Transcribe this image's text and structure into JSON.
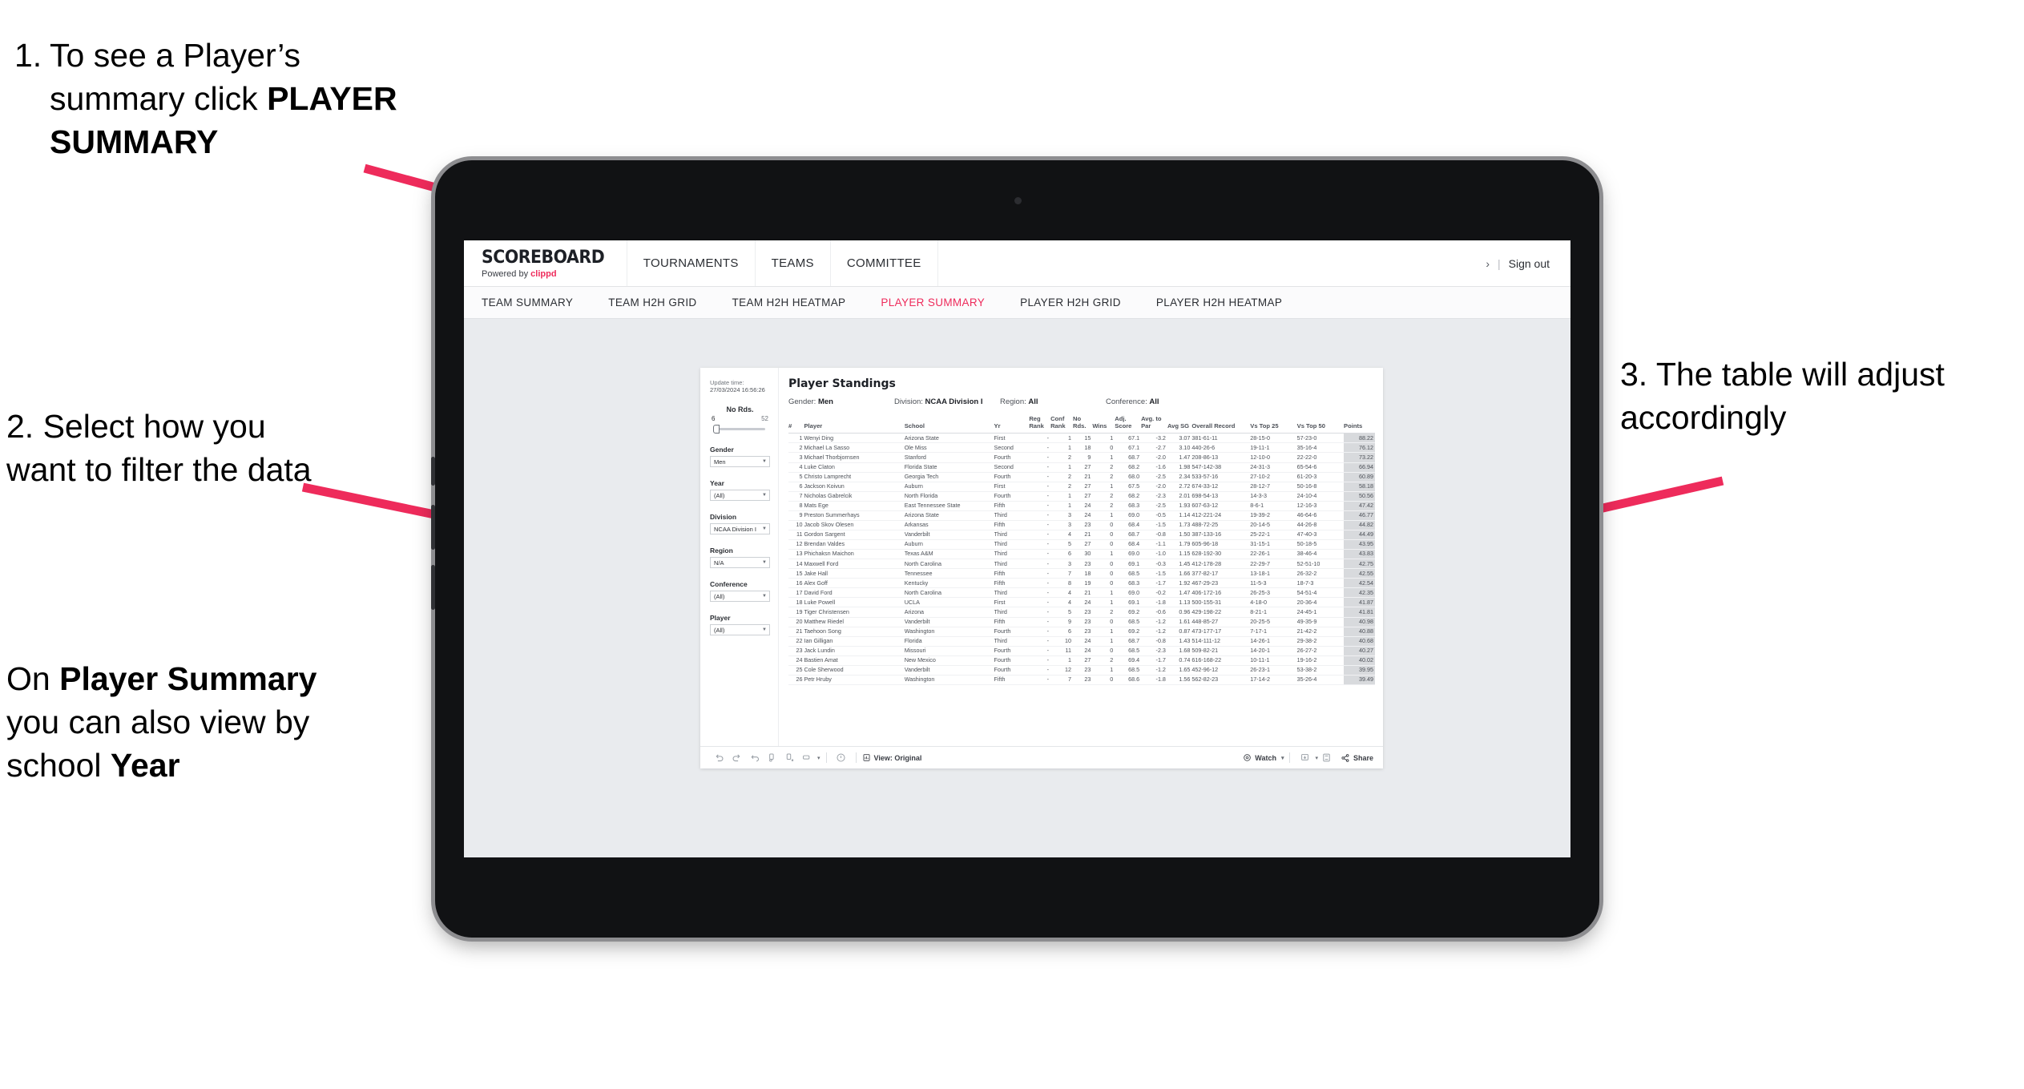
{
  "annotations": {
    "step1": {
      "number": "1.",
      "text_a": "To see a Player’s summary click ",
      "bold_a": "PLAYER SUMMARY"
    },
    "step2": {
      "text": "2. Select how you want to filter the data"
    },
    "step2b": {
      "pre": "On ",
      "bold1": "Player Summary",
      "mid": " you can also view by school ",
      "bold2": "Year"
    },
    "step3": {
      "text": "3. The table will adjust accordingly"
    }
  },
  "colors": {
    "accent": "#ee2b5b",
    "text": "#2b2e33",
    "bg": "#e9ebee"
  },
  "app": {
    "logo": {
      "word": "SCOREBOARD",
      "powered_prefix": "Powered by ",
      "brand": "clippd"
    },
    "topnav": [
      {
        "label": "TOURNAMENTS"
      },
      {
        "label": "TEAMS"
      },
      {
        "label": "COMMITTEE"
      }
    ],
    "account": {
      "chevron": "›",
      "divider": "|",
      "signout": "Sign out"
    },
    "subnav": [
      {
        "label": "TEAM SUMMARY",
        "active": false
      },
      {
        "label": "TEAM H2H GRID",
        "active": false
      },
      {
        "label": "TEAM H2H HEATMAP",
        "active": false
      },
      {
        "label": "PLAYER SUMMARY",
        "active": true
      },
      {
        "label": "PLAYER H2H GRID",
        "active": false
      },
      {
        "label": "PLAYER H2H HEATMAP",
        "active": false
      }
    ]
  },
  "workbook": {
    "update_time_label": "Update time:",
    "update_time_value": "27/03/2024 16:56:26",
    "title": "Player Standings",
    "meta": [
      {
        "label": "Gender:",
        "value": "Men"
      },
      {
        "label": "Division:",
        "value": "NCAA Division I"
      },
      {
        "label": "Region:",
        "value": "All"
      },
      {
        "label": "Conference:",
        "value": "All"
      }
    ],
    "filters": {
      "slider": {
        "label": "No Rds.",
        "min": "6",
        "max": "52"
      },
      "selects": [
        {
          "label": "Gender",
          "value": "Men"
        },
        {
          "label": "Year",
          "value": "(All)"
        },
        {
          "label": "Division",
          "value": "NCAA Division I"
        },
        {
          "label": "Region",
          "value": "N/A"
        },
        {
          "label": "Conference",
          "value": "(All)"
        },
        {
          "label": "Player",
          "value": "(All)"
        }
      ]
    },
    "toolbar": {
      "view_label": "View: Original",
      "watch_label": "Watch",
      "share_label": "Share",
      "caret": "▾"
    }
  },
  "table": {
    "columns": [
      "#",
      "Player",
      "School",
      "Yr",
      "Reg Rank",
      "Conf Rank",
      "No Rds.",
      "Wins",
      "Adj. Score",
      "Avg. to Par",
      "Avg SG",
      "Overall Record",
      "Vs Top 25",
      "Vs Top 50",
      "Points"
    ],
    "rows": [
      [
        "1",
        "Wenyi Ding",
        "Arizona State",
        "First",
        "-",
        "1",
        "15",
        "1",
        "67.1",
        "-3.2",
        "3.07",
        "381-61-11",
        "28-15-0",
        "57-23-0",
        "88.22"
      ],
      [
        "2",
        "Michael La Sasso",
        "Ole Miss",
        "Second",
        "-",
        "1",
        "18",
        "0",
        "67.1",
        "-2.7",
        "3.10",
        "440-26-6",
        "19-11-1",
        "35-16-4",
        "76.12"
      ],
      [
        "3",
        "Michael Thorbjornsen",
        "Stanford",
        "Fourth",
        "-",
        "2",
        "9",
        "1",
        "68.7",
        "-2.0",
        "1.47",
        "208-86-13",
        "12-10-0",
        "22-22-0",
        "73.22"
      ],
      [
        "4",
        "Luke Claton",
        "Florida State",
        "Second",
        "-",
        "1",
        "27",
        "2",
        "68.2",
        "-1.6",
        "1.98",
        "547-142-38",
        "24-31-3",
        "65-54-6",
        "66.94"
      ],
      [
        "5",
        "Christo Lamprecht",
        "Georgia Tech",
        "Fourth",
        "-",
        "2",
        "21",
        "2",
        "68.0",
        "-2.5",
        "2.34",
        "533-57-16",
        "27-10-2",
        "61-20-3",
        "60.89"
      ],
      [
        "6",
        "Jackson Koivun",
        "Auburn",
        "First",
        "-",
        "2",
        "27",
        "1",
        "67.5",
        "-2.0",
        "2.72",
        "674-33-12",
        "28-12-7",
        "50-16-8",
        "58.18"
      ],
      [
        "7",
        "Nicholas Gabrelcik",
        "North Florida",
        "Fourth",
        "-",
        "1",
        "27",
        "2",
        "68.2",
        "-2.3",
        "2.01",
        "698-54-13",
        "14-3-3",
        "24-10-4",
        "50.56"
      ],
      [
        "8",
        "Mats Ege",
        "East Tennessee State",
        "Fifth",
        "-",
        "1",
        "24",
        "2",
        "68.3",
        "-2.5",
        "1.93",
        "607-63-12",
        "8-6-1",
        "12-16-3",
        "47.42"
      ],
      [
        "9",
        "Preston Summerhays",
        "Arizona State",
        "Third",
        "-",
        "3",
        "24",
        "1",
        "69.0",
        "-0.5",
        "1.14",
        "412-221-24",
        "19-39-2",
        "46-64-6",
        "46.77"
      ],
      [
        "10",
        "Jacob Skov Olesen",
        "Arkansas",
        "Fifth",
        "-",
        "3",
        "23",
        "0",
        "68.4",
        "-1.5",
        "1.73",
        "488-72-25",
        "20-14-5",
        "44-26-8",
        "44.82"
      ],
      [
        "11",
        "Gordon Sargent",
        "Vanderbilt",
        "Third",
        "-",
        "4",
        "21",
        "0",
        "68.7",
        "-0.8",
        "1.50",
        "387-133-16",
        "25-22-1",
        "47-40-3",
        "44.49"
      ],
      [
        "12",
        "Brendan Valdes",
        "Auburn",
        "Third",
        "-",
        "5",
        "27",
        "0",
        "68.4",
        "-1.1",
        "1.79",
        "605-96-18",
        "31-15-1",
        "50-18-5",
        "43.95"
      ],
      [
        "13",
        "Phichaksn Maichon",
        "Texas A&M",
        "Third",
        "-",
        "6",
        "30",
        "1",
        "69.0",
        "-1.0",
        "1.15",
        "628-192-30",
        "22-26-1",
        "38-46-4",
        "43.83"
      ],
      [
        "14",
        "Maxwell Ford",
        "North Carolina",
        "Third",
        "-",
        "3",
        "23",
        "0",
        "69.1",
        "-0.3",
        "1.45",
        "412-178-28",
        "22-29-7",
        "52-51-10",
        "42.75"
      ],
      [
        "15",
        "Jake Hall",
        "Tennessee",
        "Fifth",
        "-",
        "7",
        "18",
        "0",
        "68.5",
        "-1.5",
        "1.66",
        "377-82-17",
        "13-18-1",
        "26-32-2",
        "42.55"
      ],
      [
        "16",
        "Alex Goff",
        "Kentucky",
        "Fifth",
        "-",
        "8",
        "19",
        "0",
        "68.3",
        "-1.7",
        "1.92",
        "467-29-23",
        "11-5-3",
        "18-7-3",
        "42.54"
      ],
      [
        "17",
        "David Ford",
        "North Carolina",
        "Third",
        "-",
        "4",
        "21",
        "1",
        "69.0",
        "-0.2",
        "1.47",
        "406-172-16",
        "26-25-3",
        "54-51-4",
        "42.35"
      ],
      [
        "18",
        "Luke Powell",
        "UCLA",
        "First",
        "-",
        "4",
        "24",
        "1",
        "69.1",
        "-1.8",
        "1.13",
        "500-155-31",
        "4-18-0",
        "20-36-4",
        "41.87"
      ],
      [
        "19",
        "Tiger Christensen",
        "Arizona",
        "Third",
        "-",
        "5",
        "23",
        "2",
        "69.2",
        "-0.6",
        "0.96",
        "429-198-22",
        "8-21-1",
        "24-45-1",
        "41.81"
      ],
      [
        "20",
        "Matthew Riedel",
        "Vanderbilt",
        "Fifth",
        "-",
        "9",
        "23",
        "0",
        "68.5",
        "-1.2",
        "1.61",
        "448-85-27",
        "20-25-5",
        "49-35-9",
        "40.98"
      ],
      [
        "21",
        "Taehoon Song",
        "Washington",
        "Fourth",
        "-",
        "6",
        "23",
        "1",
        "69.2",
        "-1.2",
        "0.87",
        "473-177-17",
        "7-17-1",
        "21-42-2",
        "40.88"
      ],
      [
        "22",
        "Ian Gilligan",
        "Florida",
        "Third",
        "-",
        "10",
        "24",
        "1",
        "68.7",
        "-0.8",
        "1.43",
        "514-111-12",
        "14-26-1",
        "29-38-2",
        "40.68"
      ],
      [
        "23",
        "Jack Lundin",
        "Missouri",
        "Fourth",
        "-",
        "11",
        "24",
        "0",
        "68.5",
        "-2.3",
        "1.68",
        "509-82-21",
        "14-20-1",
        "26-27-2",
        "40.27"
      ],
      [
        "24",
        "Bastien Amat",
        "New Mexico",
        "Fourth",
        "-",
        "1",
        "27",
        "2",
        "69.4",
        "-1.7",
        "0.74",
        "616-168-22",
        "10-11-1",
        "19-16-2",
        "40.02"
      ],
      [
        "25",
        "Cole Sherwood",
        "Vanderbilt",
        "Fourth",
        "-",
        "12",
        "23",
        "1",
        "68.5",
        "-1.2",
        "1.65",
        "452-96-12",
        "26-23-1",
        "53-38-2",
        "39.95"
      ],
      [
        "26",
        "Petr Hruby",
        "Washington",
        "Fifth",
        "-",
        "7",
        "23",
        "0",
        "68.6",
        "-1.8",
        "1.56",
        "562-82-23",
        "17-14-2",
        "35-26-4",
        "39.49"
      ]
    ]
  }
}
